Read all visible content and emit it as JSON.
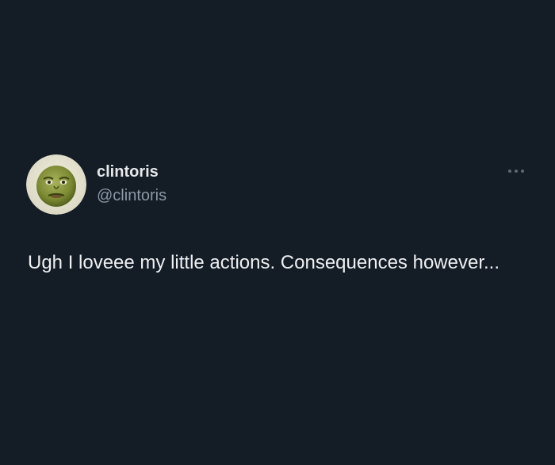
{
  "tweet": {
    "author": {
      "display_name": "clintoris",
      "handle": "@clintoris",
      "avatar_icon": "green-face-avatar"
    },
    "more_icon": "more-dots-icon",
    "text": "Ugh I loveee my little actions. Consequences however..."
  },
  "colors": {
    "background": "#141c26",
    "primary_text": "#e7e9ea",
    "secondary_text": "#8b98a5"
  }
}
